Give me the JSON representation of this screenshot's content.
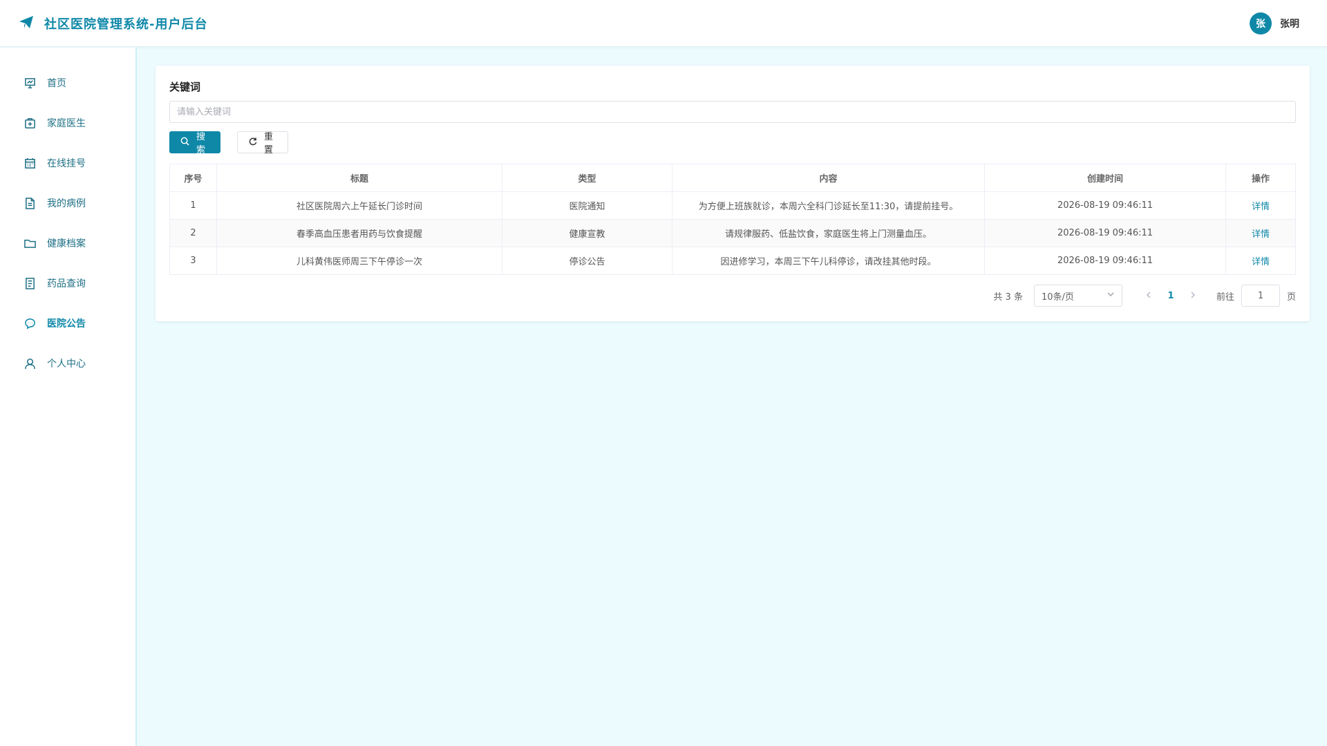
{
  "header": {
    "title": "社区医院管理系统-用户后台",
    "avatar_text": "张",
    "user_name": "张明"
  },
  "sidebar": {
    "items": [
      {
        "label": "首页",
        "icon": "presentation-icon"
      },
      {
        "label": "家庭医生",
        "icon": "medical-kit-icon"
      },
      {
        "label": "在线挂号",
        "icon": "calendar-icon"
      },
      {
        "label": "我的病例",
        "icon": "document-icon"
      },
      {
        "label": "健康档案",
        "icon": "folder-icon"
      },
      {
        "label": "药品查询",
        "icon": "list-document-icon"
      },
      {
        "label": "医院公告",
        "icon": "chat-bubble-icon"
      },
      {
        "label": "个人中心",
        "icon": "user-icon"
      }
    ],
    "active_index": 6
  },
  "search": {
    "label": "关键词",
    "placeholder": "请输入关键词",
    "value": "",
    "search_button": "搜索",
    "reset_button": "重置"
  },
  "table": {
    "columns": [
      "序号",
      "标题",
      "类型",
      "内容",
      "创建时间",
      "操作"
    ],
    "rows": [
      {
        "index": "1",
        "title": "社区医院周六上午延长门诊时间",
        "type": "医院通知",
        "content": "为方便上班族就诊，本周六全科门诊延长至11:30，请提前挂号。",
        "created": "2026-08-19 09:46:11",
        "action": "详情"
      },
      {
        "index": "2",
        "title": "春季高血压患者用药与饮食提醒",
        "type": "健康宣教",
        "content": "请规律服药、低盐饮食，家庭医生将上门测量血压。",
        "created": "2026-08-19 09:46:11",
        "action": "详情"
      },
      {
        "index": "3",
        "title": "儿科黄伟医师周三下午停诊一次",
        "type": "停诊公告",
        "content": "因进修学习，本周三下午儿科停诊，请改挂其他时段。",
        "created": "2026-08-19 09:46:11",
        "action": "详情"
      }
    ]
  },
  "pagination": {
    "total_text": "共 3 条",
    "page_size": "10条/页",
    "current_page": "1",
    "goto_label": "前往",
    "goto_value": "1",
    "page_suffix": "页"
  },
  "colors": {
    "accent": "#0f88a8",
    "background": "#ebfbfe"
  }
}
